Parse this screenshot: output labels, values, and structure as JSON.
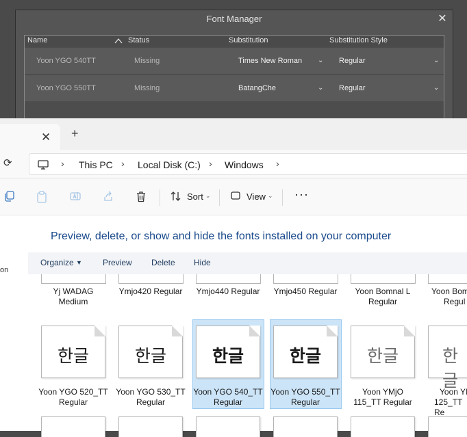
{
  "font_manager": {
    "title": "Font Manager",
    "columns": [
      "Name",
      "Status",
      "Substitution",
      "Substitution Style"
    ],
    "rows": [
      {
        "name": "Yoon YGO 540TT",
        "status": "Missing",
        "substitution": "Times New Roman",
        "style": "Regular"
      },
      {
        "name": "Yoon YGO 550TT",
        "status": "Missing",
        "substitution": "BatangChe",
        "style": "Regular"
      }
    ]
  },
  "explorer": {
    "breadcrumb": [
      "This PC",
      "Local Disk (C:)",
      "Windows"
    ],
    "toolbar": {
      "sort": "Sort",
      "view": "View"
    },
    "sidebar_fragment": "on",
    "heading": "Preview, delete, or show and hide the fonts installed on your computer",
    "actions": {
      "organize": "Organize",
      "preview": "Preview",
      "delete": "Delete",
      "hide": "Hide"
    },
    "top_row": [
      {
        "l1": "Yj WADAG",
        "l2": "Medium"
      },
      {
        "l1": "Ymjo420 Regular",
        "l2": ""
      },
      {
        "l1": "Ymjo440 Regular",
        "l2": ""
      },
      {
        "l1": "Ymjo450 Regular",
        "l2": ""
      },
      {
        "l1": "Yoon Bomnal L",
        "l2": "Regular"
      },
      {
        "l1": "Yoon Bom",
        "l2": "Regul"
      }
    ],
    "fonts": [
      {
        "glyph": "한글",
        "l1": "Yoon YGO 520_TT",
        "l2": "Regular"
      },
      {
        "glyph": "한글",
        "l1": "Yoon YGO 530_TT",
        "l2": "Regular"
      },
      {
        "glyph": "한글",
        "l1": "Yoon YGO 540_TT",
        "l2": "Regular"
      },
      {
        "glyph": "한글",
        "l1": "Yoon YGO 550_TT",
        "l2": "Regular"
      },
      {
        "glyph": "한글",
        "l1": "Yoon YMjO",
        "l2": "115_TT Regular"
      },
      {
        "glyph": "한글",
        "l1": "Yoon YI",
        "l2": "125_TT Re"
      }
    ],
    "selection_color": "#cce4f7",
    "accent_text": "#1a4a8c"
  }
}
